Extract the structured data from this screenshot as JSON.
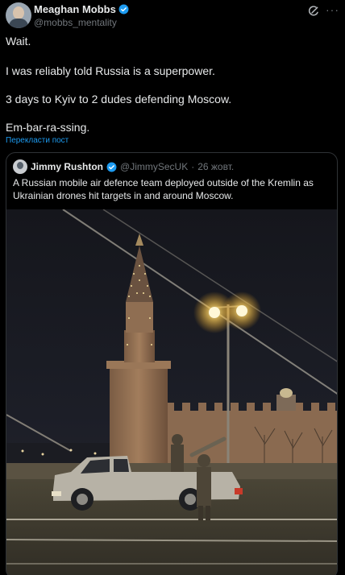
{
  "author": {
    "display_name": "Meaghan Mobbs",
    "handle": "@mobbs_mentality"
  },
  "tweet": {
    "lines": [
      "Wait.",
      "I was reliably told Russia is a superpower.",
      "3 days to Kyiv to 2 dudes defending Moscow.",
      "Em-bar-ra-ssing."
    ],
    "translate_label": "Перекласти пост"
  },
  "quoted": {
    "display_name": "Jimmy Rushton",
    "handle": "@JimmySecUK",
    "separator": "·",
    "date": "26 жовт.",
    "text": "A Russian mobile air defence team deployed outside of the Kremlin as Ukrainian drones hit targets in and around Moscow."
  },
  "icons": {
    "verified": "verified-badge-icon",
    "grok": "grok-icon",
    "more": "more-icon"
  },
  "colors": {
    "background": "#000000",
    "text": "#e7e9ea",
    "secondary": "#71767b",
    "link": "#1d9bf0",
    "border": "#2f3336"
  }
}
